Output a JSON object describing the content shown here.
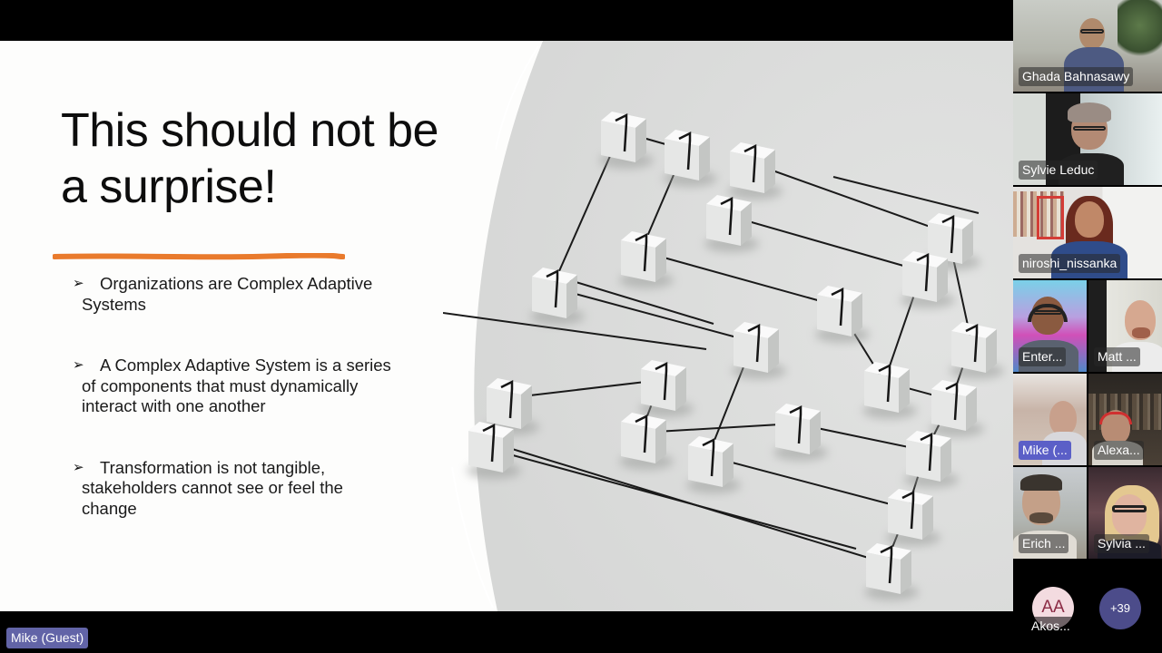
{
  "meeting": {
    "active_speaker_label": "Mike (Guest)"
  },
  "slide": {
    "title": "This should not be a surprise!",
    "accent_color": "#e97a2c",
    "bullet_icon": "arrowhead-bullet",
    "bullets": [
      {
        "text": "Organizations are Complex Adaptive Systems"
      },
      {
        "text": "A Complex Adaptive System is a series of components that must dynamically interact with one another"
      },
      {
        "text": "Transformation is not tangible, stakeholders cannot see or feel the change"
      }
    ],
    "illustration": "connected-cubes-network"
  },
  "participants": [
    {
      "name": "Ghada Bahnasawy",
      "speaking": false
    },
    {
      "name": "Sylvie Leduc",
      "speaking": false
    },
    {
      "name": "niroshi_nissanka",
      "speaking": false
    },
    {
      "name": "Enter...",
      "speaking": false
    },
    {
      "name": "Matt ...",
      "speaking": false
    },
    {
      "name": "Mike (...",
      "speaking": true
    },
    {
      "name": "Alexa...",
      "speaking": false
    },
    {
      "name": "Erich ...",
      "speaking": false
    },
    {
      "name": "Sylvia ...",
      "speaking": false
    }
  ],
  "overflow": {
    "avatar_initials": "AA",
    "avatar_name": "Akos...",
    "more_count": "+39"
  }
}
